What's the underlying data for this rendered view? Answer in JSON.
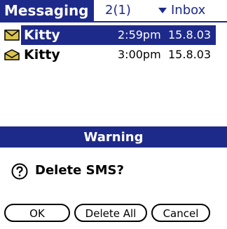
{
  "header": {
    "app_title": "Messaging",
    "count": "2(1)",
    "category": "Inbox"
  },
  "messages": [
    {
      "sender": "Kitty",
      "time": "2:59pm",
      "date": "15.8.03",
      "selected": true,
      "icon": "envelope-icon"
    },
    {
      "sender": "Kitty",
      "time": "3:00pm",
      "date": "15.8.03",
      "selected": false,
      "icon": "envelope-open-icon"
    }
  ],
  "dialog": {
    "title": "Warning",
    "icon": "question-icon",
    "message": "Delete SMS?",
    "buttons": {
      "ok": "OK",
      "delete_all": "Delete All",
      "cancel": "Cancel"
    }
  },
  "colors": {
    "accent": "#1e2a8a",
    "envelope": "#d9c34a"
  }
}
